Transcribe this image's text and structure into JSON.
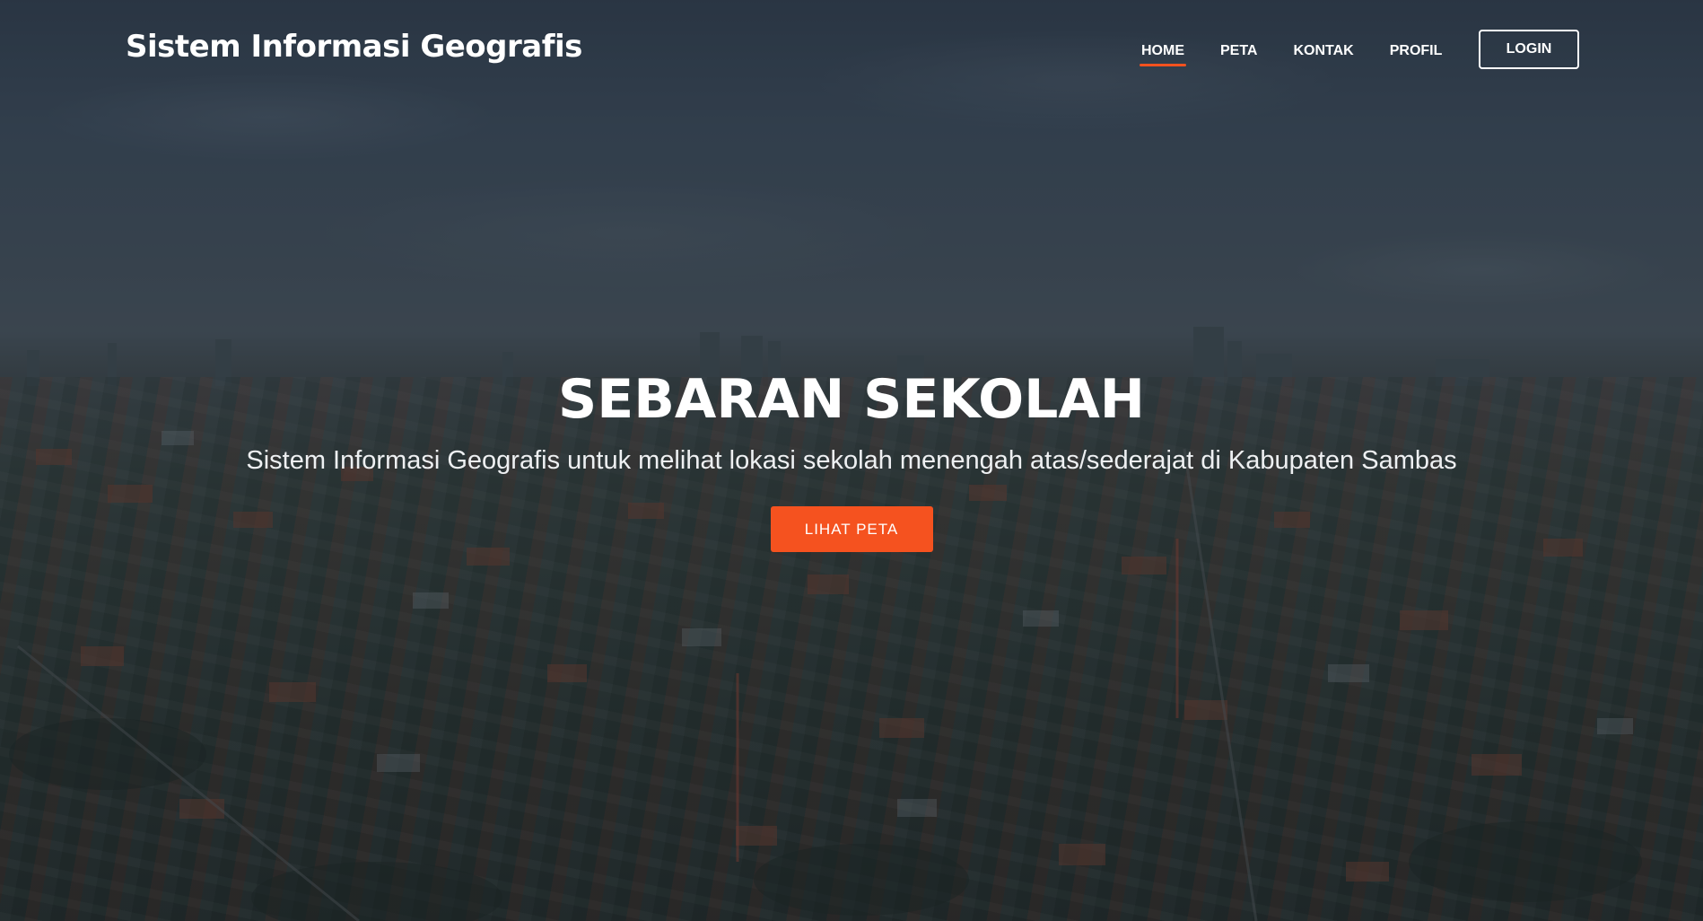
{
  "brand": {
    "title": "Sistem Informasi Geografis"
  },
  "nav": {
    "items": [
      {
        "label": "HOME",
        "active": true
      },
      {
        "label": "PETA",
        "active": false
      },
      {
        "label": "KONTAK",
        "active": false
      },
      {
        "label": "PROFIL",
        "active": false
      }
    ],
    "login_label": "LOGIN"
  },
  "hero": {
    "title": "SEBARAN SEKOLAH",
    "subtitle": "Sistem Informasi Geografis untuk melihat lokasi sekolah menengah atas/sederajat di Kabupaten Sambas",
    "cta_label": "LIHAT PETA",
    "background_image": "aerial-city-photo"
  },
  "colors": {
    "accent": "#f5521f",
    "text": "#ffffff",
    "overlay": "#141c26"
  }
}
